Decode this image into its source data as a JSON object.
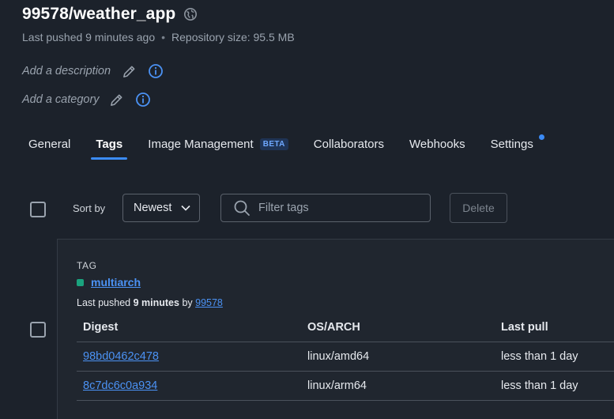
{
  "repo": {
    "name": "99578/weather_app",
    "last_pushed": "Last pushed 9 minutes ago",
    "separator": "•",
    "size": "Repository size: 95.5 MB"
  },
  "details": {
    "description_placeholder": "Add a description",
    "category_placeholder": "Add a category"
  },
  "tabs": [
    {
      "label": "General"
    },
    {
      "label": "Tags"
    },
    {
      "label": "Image Management",
      "badge": "BETA"
    },
    {
      "label": "Collaborators"
    },
    {
      "label": "Webhooks"
    },
    {
      "label": "Settings"
    }
  ],
  "toolbar": {
    "sort_label": "Sort by",
    "sort_value": "Newest",
    "filter_placeholder": "Filter tags",
    "delete_label": "Delete"
  },
  "tag": {
    "header": "TAG",
    "name": "multiarch",
    "pushed_prefix": "Last pushed",
    "pushed_time": "9 minutes",
    "pushed_by": "by",
    "pushed_user": "99578",
    "columns": [
      "Digest",
      "OS/ARCH",
      "Last pull"
    ],
    "rows": [
      {
        "digest": "98bd0462c478",
        "os_arch": "linux/amd64",
        "last_pull": "less than 1 day"
      },
      {
        "digest": "8c7dc6c0a934",
        "os_arch": "linux/arm64",
        "last_pull": "less than 1 day"
      }
    ]
  },
  "colors": {
    "background": "#1c222b",
    "accent": "#3b8bf5",
    "link": "#4b92f4",
    "status_green": "#1aa37e"
  },
  "icons": {
    "visibility": "globe-icon",
    "edit": "pencil-icon",
    "info": "info-icon",
    "search": "search-icon",
    "dropdown": "chevron-down-icon"
  }
}
